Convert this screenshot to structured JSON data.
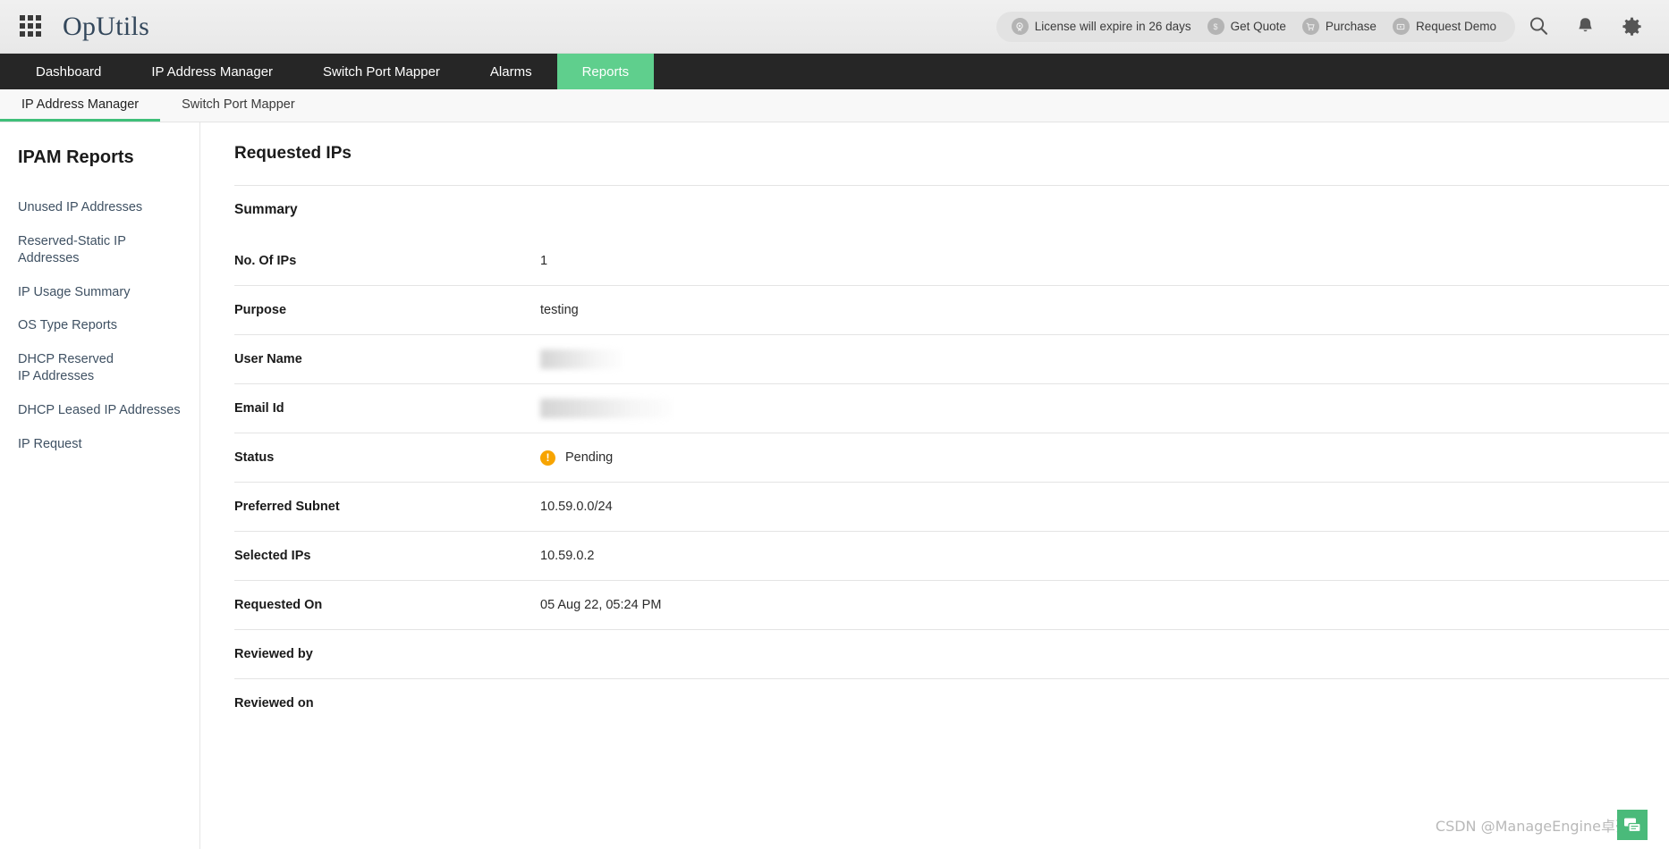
{
  "header": {
    "app_menu_icon": "grid-apps-icon",
    "brand": "OpUtils",
    "license_items": [
      {
        "label": "License will expire in 26 days",
        "icon": "license-badge-icon"
      },
      {
        "label": "Get Quote",
        "icon": "dollar-icon"
      },
      {
        "label": "Purchase",
        "icon": "cart-icon"
      },
      {
        "label": "Request Demo",
        "icon": "video-icon"
      }
    ],
    "actions": [
      {
        "name": "search-icon",
        "label": "Search"
      },
      {
        "name": "notification-bell-icon",
        "label": "Notifications"
      },
      {
        "name": "gear-icon",
        "label": "Settings"
      }
    ]
  },
  "main_nav": {
    "items": [
      {
        "label": "Dashboard",
        "active": false
      },
      {
        "label": "IP Address Manager",
        "active": false
      },
      {
        "label": "Switch Port Mapper",
        "active": false
      },
      {
        "label": "Alarms",
        "active": false
      },
      {
        "label": "Reports",
        "active": true
      }
    ],
    "active_color": "#5fcf8d"
  },
  "sub_nav": {
    "items": [
      {
        "label": "IP Address Manager",
        "active": true
      },
      {
        "label": "Switch Port Mapper",
        "active": false
      }
    ],
    "active_underline_color": "#3fbf79"
  },
  "sidebar": {
    "title": "IPAM Reports",
    "items": [
      {
        "label": "Unused IP Addresses"
      },
      {
        "label": "Reserved-Static IP Addresses"
      },
      {
        "label": "IP Usage Summary"
      },
      {
        "label": "OS Type Reports"
      },
      {
        "label": "DHCP Reserved IP Addresses"
      },
      {
        "label": "DHCP Leased IP Addresses"
      },
      {
        "label": "IP Request"
      }
    ]
  },
  "main": {
    "page_title": "Requested IPs",
    "section_title": "Summary",
    "rows": [
      {
        "label": "No. Of IPs",
        "value": "1",
        "type": "text"
      },
      {
        "label": "Purpose",
        "value": "testing",
        "type": "text"
      },
      {
        "label": "User Name",
        "value": "",
        "type": "redacted-name"
      },
      {
        "label": "Email Id",
        "value": "",
        "type": "redacted-email"
      },
      {
        "label": "Status",
        "value": "Pending",
        "type": "status",
        "status_color": "#f7a400",
        "status_icon": "warning-exclamation-icon"
      },
      {
        "label": "Preferred Subnet",
        "value": "10.59.0.0/24",
        "type": "text"
      },
      {
        "label": "Selected IPs",
        "value": "10.59.0.2",
        "type": "text"
      },
      {
        "label": "Requested On",
        "value": "05 Aug 22, 05:24 PM",
        "type": "text"
      },
      {
        "label": "Reviewed by",
        "value": "",
        "type": "text"
      },
      {
        "label": "Reviewed on",
        "value": "",
        "type": "text"
      }
    ]
  },
  "watermark": {
    "text": "CSDN @ManageEngine卓豪",
    "logo_icon": "csdn-chat-logo-icon",
    "logo_color": "#4aba7a"
  }
}
